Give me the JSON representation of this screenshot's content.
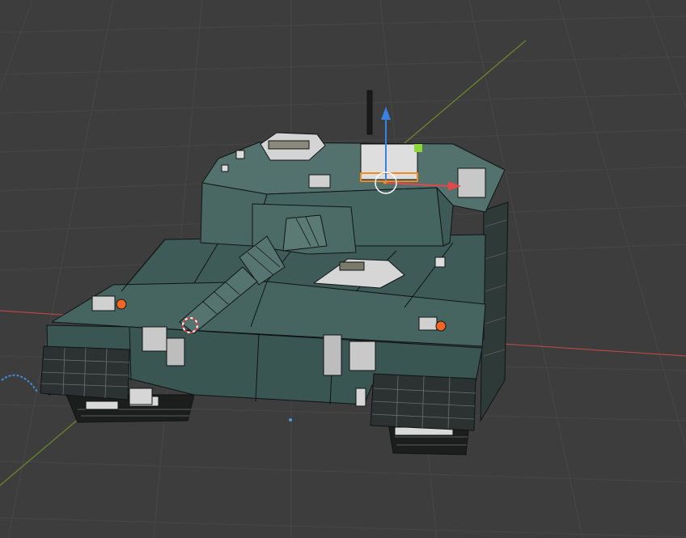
{
  "viewport": {
    "background": "#3d3d3d",
    "grid_color": "#474747",
    "axis_x_color": "#b34848",
    "axis_y_color": "#6e8a2a"
  },
  "gizmo": {
    "x_axis_color": "#e0484a",
    "z_axis_color": "#3a82e0",
    "selection_color": "#f08a24"
  },
  "model": {
    "hull_color": "#3e5a57",
    "turret_color": "#4a6863",
    "wire_color": "#101414",
    "origin_color": "#f26522"
  },
  "cursor_3d": {
    "ring_colors": [
      "#e23b3b",
      "#ffffff"
    ]
  }
}
